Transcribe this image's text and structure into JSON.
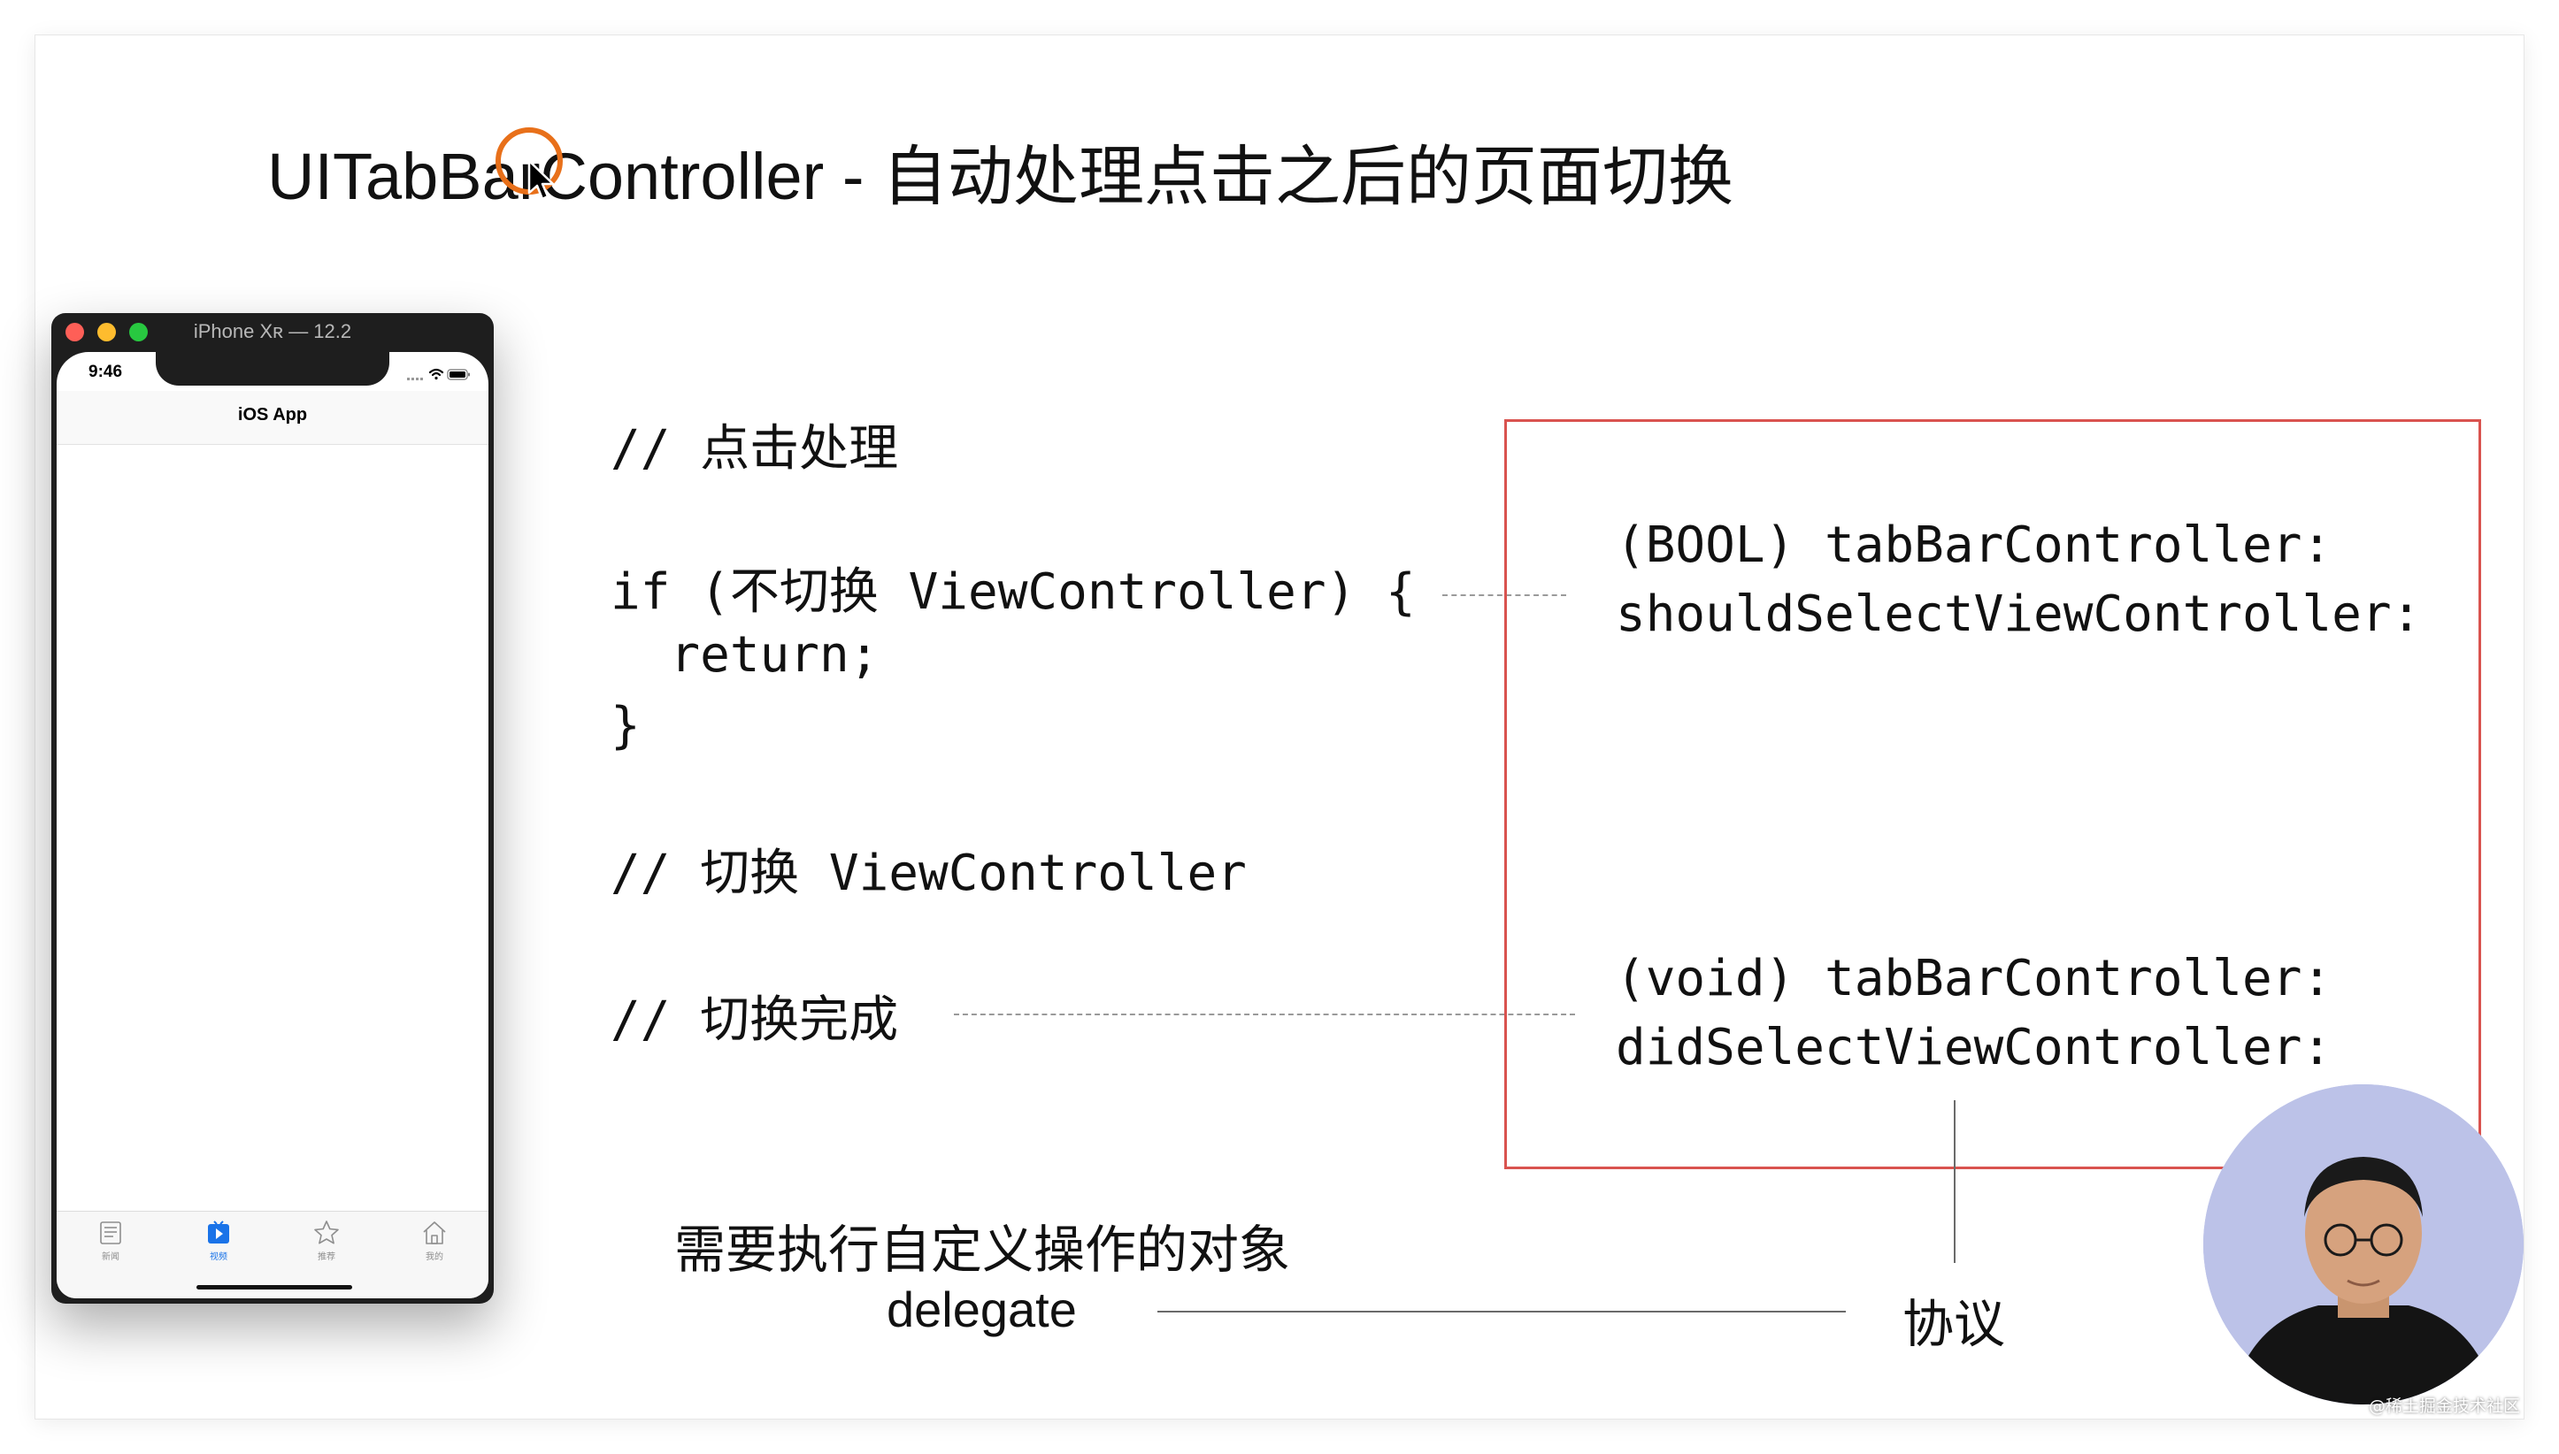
{
  "slide": {
    "title": "UITabBarController - 自动处理点击之后的页面切换"
  },
  "simulator": {
    "window_title": "iPhone Xʀ — 12.2",
    "status_time": "9:46",
    "nav_title": "iOS App",
    "tabs": [
      {
        "label": "新闻",
        "icon": "newspaper-icon",
        "active": false
      },
      {
        "label": "视频",
        "icon": "play-icon",
        "active": true
      },
      {
        "label": "推荐",
        "icon": "star-icon",
        "active": false
      },
      {
        "label": "我的",
        "icon": "home-icon",
        "active": false
      }
    ],
    "colors": {
      "active_tab": "#1a73e8",
      "inactive_tab": "#8e8e8e"
    }
  },
  "code": {
    "comment_click": "// 点击处理",
    "if_line": "if (不切换 ViewController) {",
    "return_line": "  return;",
    "close_brace": "}",
    "comment_switch": "// 切换 ViewController",
    "comment_done": "// 切换完成"
  },
  "delegate_methods": {
    "should_line1": "(BOOL) tabBarController:",
    "should_line2": "shouldSelectViewController:",
    "did_line1": "(void) tabBarController:",
    "did_line2": "didSelectViewController:",
    "box_color": "#d9534f"
  },
  "labels": {
    "custom_object": "需要执行自定义操作的对象",
    "delegate": "delegate",
    "protocol": "协议"
  },
  "watermark": "@稀土掘金技术社区"
}
